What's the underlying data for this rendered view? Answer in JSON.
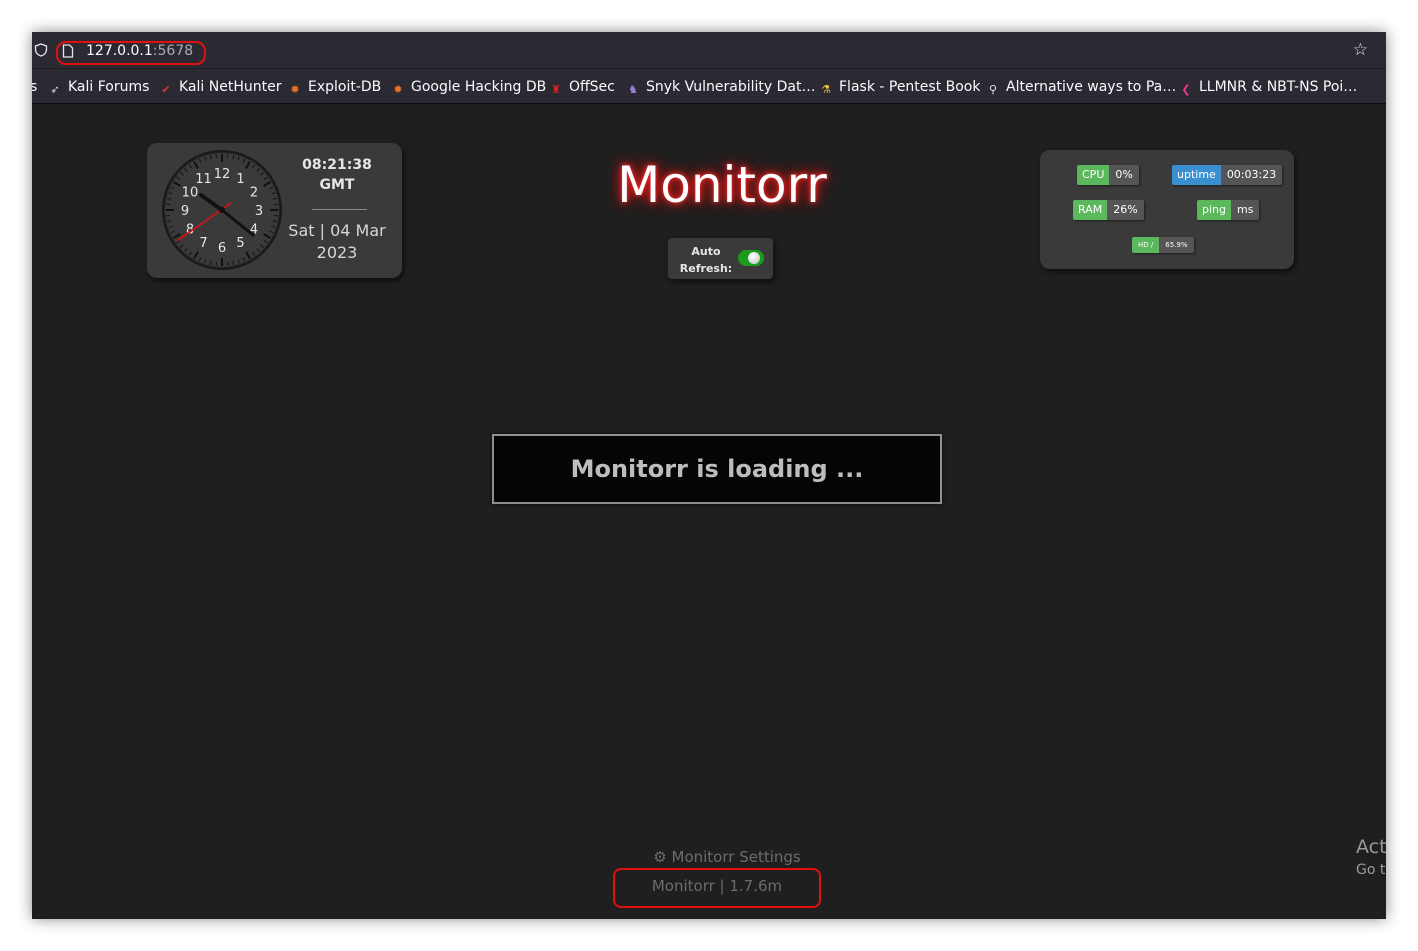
{
  "browser": {
    "url_host": "127.0.0.1",
    "url_port": ":5678",
    "bookmarks": [
      {
        "label": "s",
        "icon": ""
      },
      {
        "label": "Kali Forums",
        "icon": "kali-dragon-icon"
      },
      {
        "label": "Kali NetHunter",
        "icon": "nethunter-icon"
      },
      {
        "label": "Exploit-DB",
        "icon": "exploit-db-icon"
      },
      {
        "label": "Google Hacking DB",
        "icon": "ghdb-icon"
      },
      {
        "label": "OffSec",
        "icon": "offsec-icon"
      },
      {
        "label": "Snyk Vulnerability Dat…",
        "icon": "snyk-icon"
      },
      {
        "label": "Flask - Pentest Book",
        "icon": "flask-icon"
      },
      {
        "label": "Alternative ways to Pa…",
        "icon": "bookmark-icon"
      },
      {
        "label": "LLMNR & NBT-NS Poi…",
        "icon": "llmnr-icon"
      }
    ]
  },
  "clock": {
    "time": "08:21:38",
    "timezone": "GMT",
    "date_line1": "Sat | 04 Mar",
    "date_line2": "2023",
    "numbers": [
      "12",
      "1",
      "2",
      "3",
      "4",
      "5",
      "6",
      "7",
      "8",
      "9",
      "10",
      "11"
    ]
  },
  "app": {
    "title": "Monitorr",
    "auto_refresh_line1": "Auto",
    "auto_refresh_line2": "Refresh:",
    "auto_refresh_on": true,
    "loading_text": "Monitorr is loading ...",
    "settings_label": "Monitorr Settings",
    "version_label": "Monitorr | 1.7.6m"
  },
  "stats": {
    "cpu_label": "CPU",
    "cpu_value": "0%",
    "uptime_label": "uptime",
    "uptime_value": "00:03:23",
    "ram_label": "RAM",
    "ram_value": "26%",
    "ping_label": "ping",
    "ping_value": "ms",
    "hd_label": "HD /",
    "hd_value": "65.9%"
  },
  "overlay": {
    "line1": "Act",
    "line2": "Go t"
  },
  "colors": {
    "accent_red": "#e01010",
    "green": "#5cb85c",
    "blue": "#3a8fd0",
    "background": "#1f1f1f"
  }
}
